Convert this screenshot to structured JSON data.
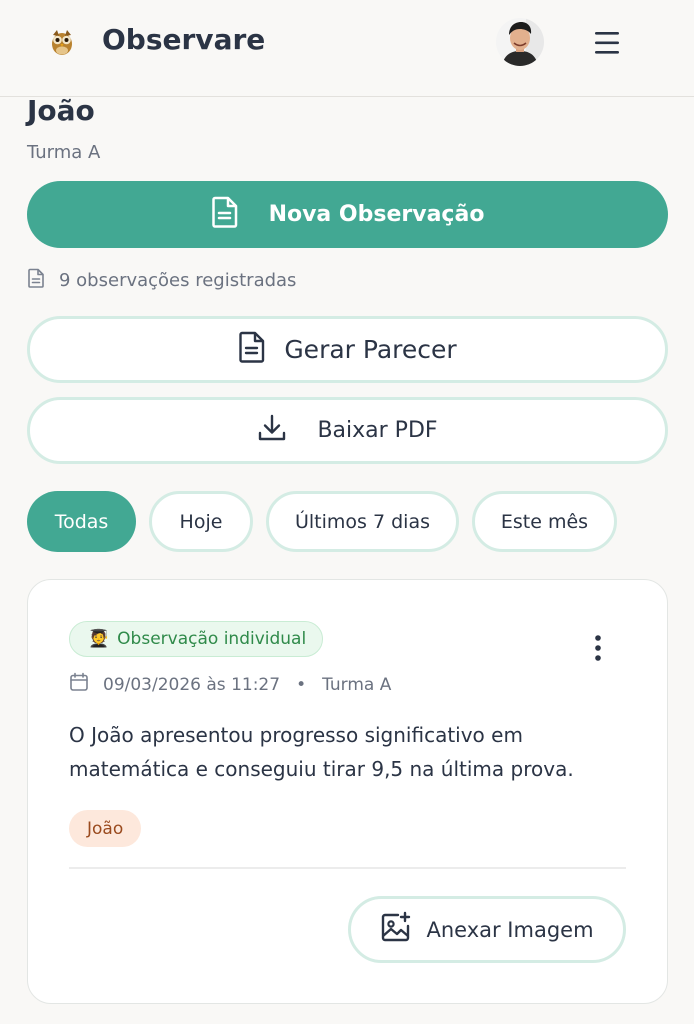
{
  "header": {
    "app_title": "Observare",
    "logo_icon": "owl-logo",
    "avatar_icon": "user-avatar",
    "menu_icon": "hamburger-menu-icon"
  },
  "student": {
    "name": "João",
    "class_name": "Turma A"
  },
  "actions": {
    "new_observation": "Nova Observação",
    "observations_count": "9 observações registradas",
    "generate_report": "Gerar Parecer",
    "download_pdf": "Baixar PDF"
  },
  "filters": [
    {
      "label": "Todas",
      "active": true
    },
    {
      "label": "Hoje",
      "active": false
    },
    {
      "label": "Últimos 7 dias",
      "active": false
    },
    {
      "label": "Este mês",
      "active": false
    }
  ],
  "observation": {
    "type_label": "Observação individual",
    "type_emoji": "🧑‍🎓",
    "date": "09/03/2026 às 11:27",
    "separator": "•",
    "class_name": "Turma A",
    "text": "O João apresentou progresso significativo em matemática e conseguiu tirar 9,5 na última prova.",
    "student_tag": "João",
    "attach_label": "Anexar Imagem"
  },
  "colors": {
    "primary": "#42a893",
    "outline": "#d4ece4",
    "badge_bg": "#eaf8ee",
    "badge_text": "#2f8a4a",
    "tag_bg": "#fde8dc",
    "tag_text": "#9a4a1e"
  }
}
